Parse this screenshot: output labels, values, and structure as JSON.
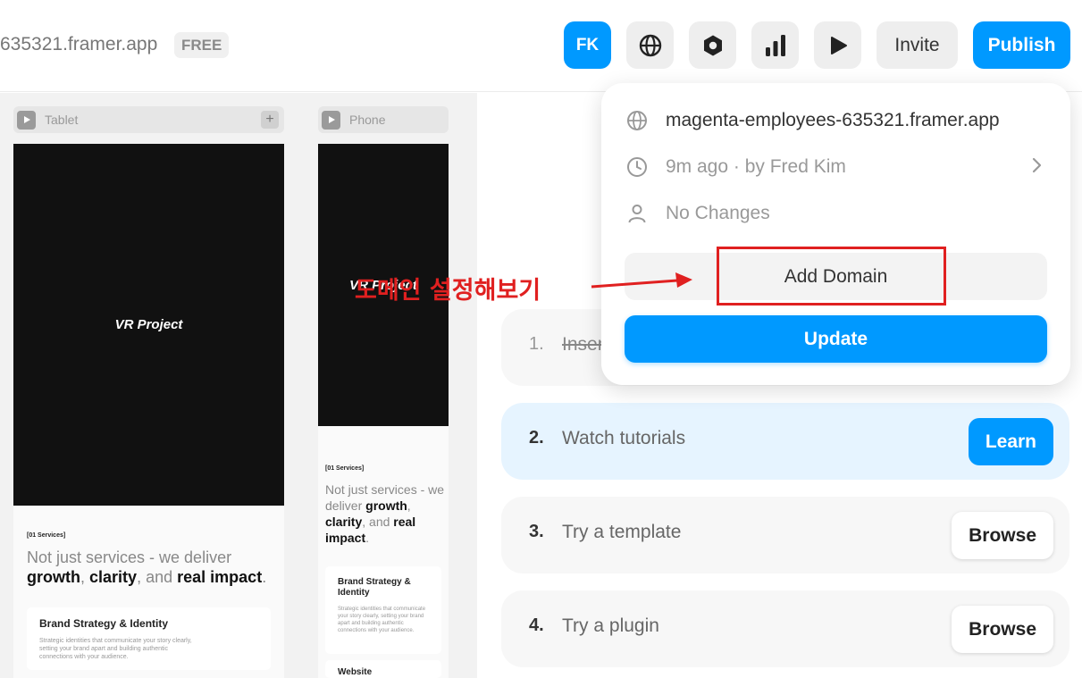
{
  "topbar": {
    "site_name": "635321.framer.app",
    "plan_badge": "FREE",
    "avatar_initials": "FK",
    "invite_label": "Invite",
    "publish_label": "Publish"
  },
  "canvas": {
    "tablet": {
      "label": "Tablet",
      "hero_title": "VR Project",
      "services_tag": "[01 Services]",
      "headline_muted_1": "Not just services - we deliver",
      "headline_bold_1": "growth",
      "headline_sep_1": ",",
      "headline_bold_2": "clarity",
      "headline_muted_2": ", and",
      "headline_bold_3": "real impact",
      "headline_end": ".",
      "card_title": "Brand Strategy & Identity",
      "card_desc": "Strategic identities that communicate your story clearly, setting your brand apart and building authentic connections with your audience."
    },
    "phone": {
      "label": "Phone",
      "hero_title": "VR Project",
      "services_tag": "[01 Services]",
      "headline_muted_1": "Not just services - we deliver",
      "headline_bold_1": "growth",
      "headline_bold_2": "clarity",
      "headline_muted_2": ", and",
      "headline_bold_3": "real",
      "headline_bold_4": "impact",
      "card1_title": "Brand Strategy & Identity",
      "card1_desc": "Strategic identities that communicate your story clearly, setting your brand apart and building authentic connections with your audience.",
      "card2_title": "Website"
    }
  },
  "popover": {
    "url": "magenta-employees-635321.framer.app",
    "last_published": "9m ago · by Fred Kim",
    "changes": "No Changes",
    "add_domain_label": "Add Domain",
    "update_label": "Update"
  },
  "steps": [
    {
      "num": "1.",
      "text": "Insert",
      "done": true
    },
    {
      "num": "2.",
      "text": "Watch tutorials",
      "button": "Learn"
    },
    {
      "num": "3.",
      "text": "Try a template",
      "button": "Browse"
    },
    {
      "num": "4.",
      "text": "Try a plugin",
      "button": "Browse"
    }
  ],
  "annotation": {
    "text": "도메인 설정해보기",
    "color": "#e02020"
  },
  "colors": {
    "accent": "#0099ff",
    "annotation_red": "#e02020"
  },
  "icons": {
    "globe": "globe-icon",
    "hexagon": "hexagon-icon",
    "chart": "bar-chart-icon",
    "play": "play-icon",
    "clock": "clock-icon",
    "user": "user-icon",
    "chevron": "chevron-right-icon"
  }
}
